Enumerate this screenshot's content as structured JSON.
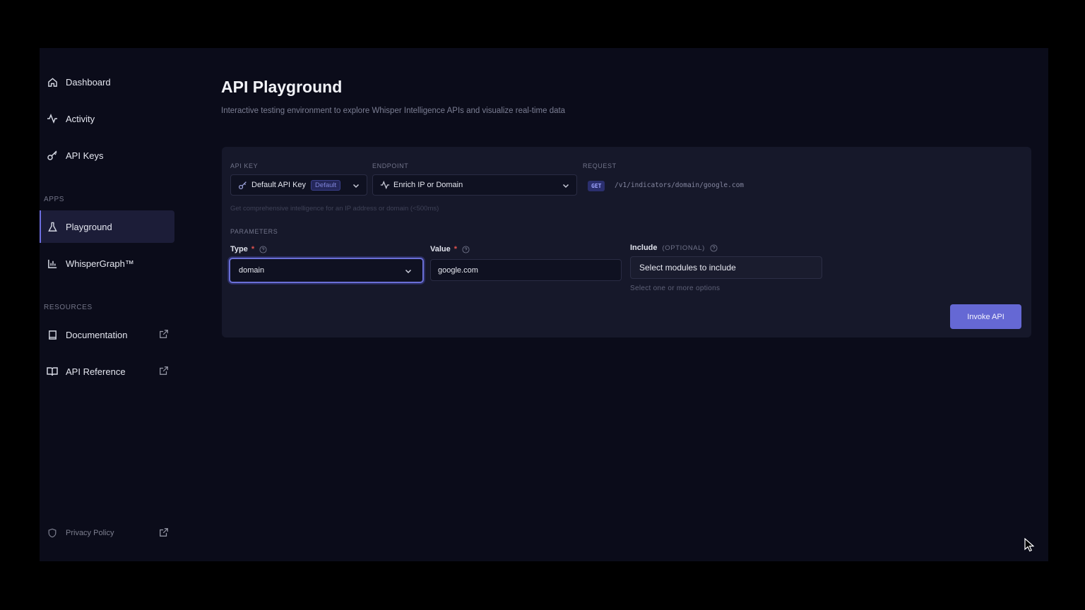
{
  "sidebar": {
    "items": [
      {
        "label": "Dashboard",
        "icon": "home-icon"
      },
      {
        "label": "Activity",
        "icon": "activity-icon"
      },
      {
        "label": "API Keys",
        "icon": "key-icon"
      }
    ],
    "apps_label": "APPS",
    "apps": [
      {
        "label": "Playground",
        "icon": "flask-icon",
        "active": true
      },
      {
        "label": "WhisperGraph™",
        "icon": "bar-chart-icon"
      }
    ],
    "resources_label": "RESOURCES",
    "resources": [
      {
        "label": "Documentation",
        "icon": "book-icon",
        "external": true
      },
      {
        "label": "API Reference",
        "icon": "book-open-icon",
        "external": true
      }
    ],
    "privacy": {
      "label": "Privacy Policy",
      "icon": "shield-icon",
      "external": true
    }
  },
  "header": {
    "title": "API Playground",
    "subtitle": "Interactive testing environment to explore Whisper Intelligence APIs and visualize real-time data"
  },
  "form": {
    "api_key": {
      "label": "API KEY",
      "value": "Default API Key",
      "badge": "Default"
    },
    "endpoint": {
      "label": "ENDPOINT",
      "value": "Enrich IP or Domain"
    },
    "request": {
      "label": "REQUEST",
      "method": "GET",
      "path": "/v1/indicators/domain/google.com"
    },
    "hint": "Get comprehensive intelligence for an IP address or domain (<500ms)",
    "parameters_label": "PARAMETERS",
    "type": {
      "label": "Type",
      "required": "*",
      "value": "domain"
    },
    "value": {
      "label": "Value",
      "required": "*",
      "value": "google.com"
    },
    "include": {
      "label": "Include",
      "optional": "(OPTIONAL)",
      "placeholder": "Select modules to include",
      "help": "Select one or more options"
    },
    "invoke_label": "Invoke API"
  },
  "colors": {
    "accent": "#6568d4",
    "background": "#0b0c1a",
    "panel": "#16182a",
    "required": "#e0524f"
  }
}
